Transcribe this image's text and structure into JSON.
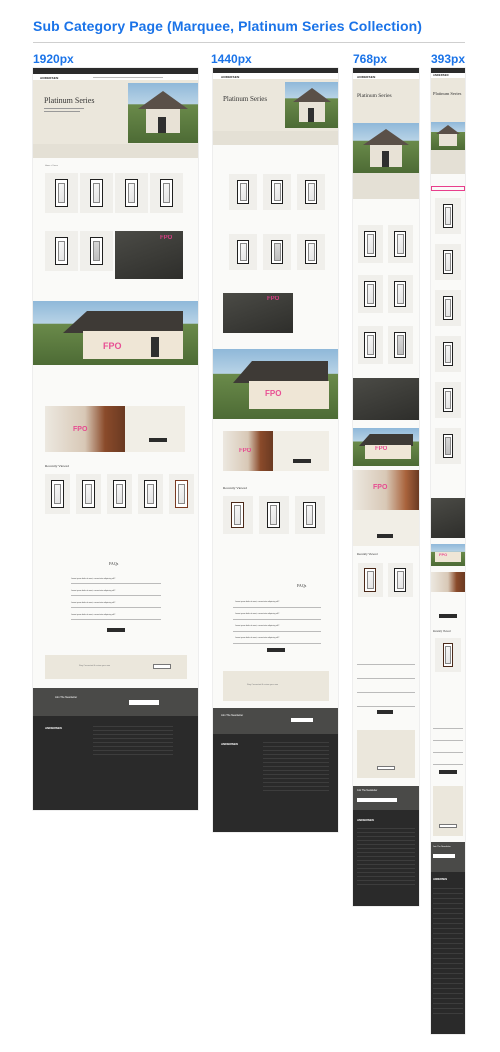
{
  "header": {
    "title": "Sub Category Page (Marquee, Platinum Series Collection)"
  },
  "breakpoints": [
    {
      "label": "1920px"
    },
    {
      "label": "1440px"
    },
    {
      "label": "768px"
    },
    {
      "label": "393px"
    }
  ],
  "mockup": {
    "brand": "ANDERSEN",
    "hero_title": "Platinum Series",
    "section_recent": "Recently Viewed",
    "section_faq": "FAQs",
    "newsletter": "Join The Newsletter",
    "fpo": "FPO",
    "faq_question": "Lorem ipsum dolor sit amet, consectetur adipiscing elit?",
    "store_banner": "Stay Connected & review your own",
    "promo_heading": "Explore the full collection"
  },
  "colors": {
    "accent": "#1a73e8",
    "footer": "#3a3a3a",
    "placeholder": "#e83e8c",
    "hero_bg": "#ebe7dc"
  }
}
